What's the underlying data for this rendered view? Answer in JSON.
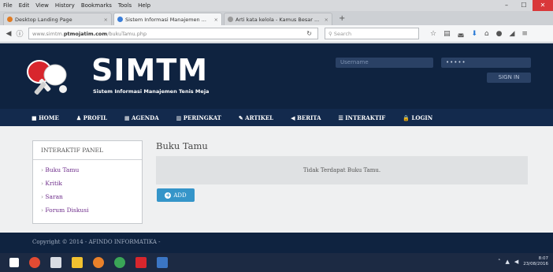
{
  "browser": {
    "menu": [
      "File",
      "Edit",
      "View",
      "History",
      "Bookmarks",
      "Tools",
      "Help"
    ],
    "tabs": [
      {
        "label": "Desktop Landing Page",
        "active": false
      },
      {
        "label": "Sistem Informasi Manajemen ...",
        "active": true
      },
      {
        "label": "Arti kata kelola - Kamus Besar ...",
        "active": false
      }
    ],
    "new_tab": "+",
    "url_prefix": "www.simtm.",
    "url_host": "ptmojatim.com",
    "url_path": "/bukuTamu.php",
    "search_placeholder": "Search",
    "window_controls": {
      "minimize": "–",
      "maximize": "☐",
      "close": "✕"
    }
  },
  "header": {
    "title": "SIMTM",
    "subtitle": "Sistem Informasi Manajemen Tenis Meja",
    "username_placeholder": "Username",
    "password_value": "•••••",
    "signin_label": "SIGN IN"
  },
  "nav": {
    "items": [
      {
        "icon": "home-icon",
        "glyph": "■",
        "label": "HOME"
      },
      {
        "icon": "user-icon",
        "glyph": "♟",
        "label": "PROFIL"
      },
      {
        "icon": "calendar-icon",
        "glyph": "▦",
        "label": "AGENDA"
      },
      {
        "icon": "chart-icon",
        "glyph": "▥",
        "label": "PERINGKAT"
      },
      {
        "icon": "pencil-icon",
        "glyph": "✎",
        "label": "ARTIKEL"
      },
      {
        "icon": "megaphone-icon",
        "glyph": "◀",
        "label": "BERITA"
      },
      {
        "icon": "chat-icon",
        "glyph": "☰",
        "label": "INTERAKTIF"
      },
      {
        "icon": "lock-icon",
        "glyph": "🔒",
        "label": "LOGIN"
      }
    ]
  },
  "sidebar": {
    "title": "INTERAKTIF PANEL",
    "items": [
      "Buku Tamu",
      "Kritik",
      "Saran",
      "Forum Diskusi"
    ]
  },
  "main": {
    "title": "Buku Tamu",
    "empty_message": "Tidak Terdapat Buku Tamu.",
    "add_label": "ADD"
  },
  "footer": {
    "copyright": "Copyright © 2014 - AFINDO INFORMATIKA -"
  },
  "taskbar": {
    "time": "8:07",
    "date": "23/08/2016"
  },
  "colors": {
    "header_bg": "#0f2340",
    "nav_bg": "#132a4d",
    "link": "#6d2b8a",
    "button": "#3595c9"
  }
}
